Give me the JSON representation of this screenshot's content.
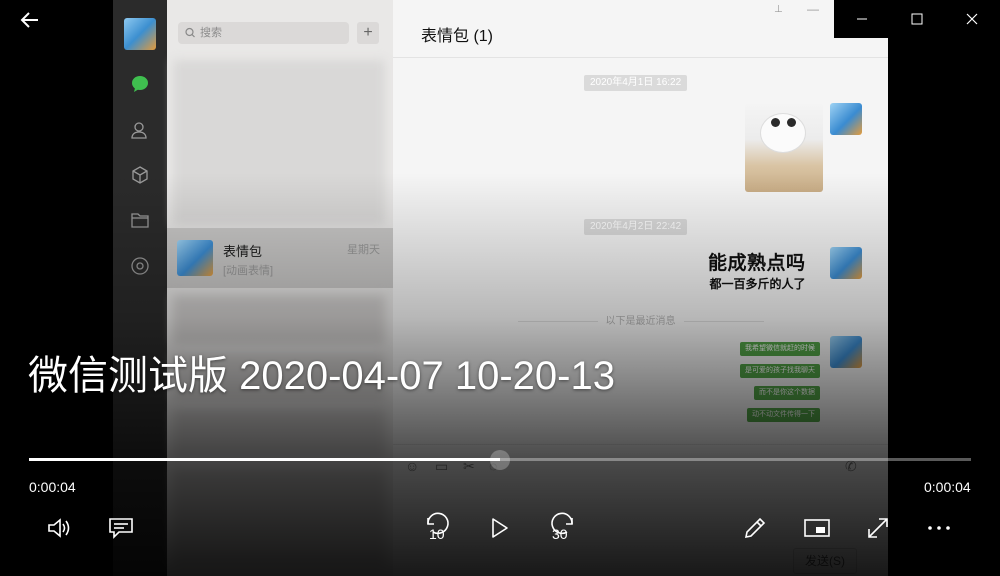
{
  "player": {
    "title": "微信测试版 2020-04-07 10-20-13",
    "time_current": "0:00:04",
    "time_total": "0:00:04",
    "progress": 0.5,
    "skip_back_label": "10",
    "skip_forward_label": "30",
    "icons": {
      "back": "arrow-left-icon",
      "volume": "volume-icon",
      "captions": "captions-icon",
      "skip_back": "skip-back-10-icon",
      "play": "play-icon",
      "skip_forward": "skip-forward-30-icon",
      "edit": "pen-icon",
      "mini_view": "mini-view-icon",
      "fullscreen": "fullscreen-icon",
      "more": "more-icon"
    }
  },
  "window_controls": {
    "minimize": "minimize-icon",
    "maximize": "maximize-icon",
    "close": "close-icon"
  },
  "wechat": {
    "search_placeholder": "搜索",
    "add_button": "+",
    "selected_chat": {
      "name": "表情包",
      "time": "星期天",
      "preview": "[动画表情]"
    },
    "chat_title": "表情包 (1)",
    "timestamps": [
      "2020年4月1日 16:22",
      "2020年4月2日 22:42"
    ],
    "sticker_text_line1": "能成熟点吗",
    "sticker_text_line2": "都一百多斤的人了",
    "recent_divider": "以下是最近消息",
    "bubbles": [
      "我希望微信就赶的时候",
      "是可爱的孩子找我聊天",
      "而不是你这个数据",
      "动不动文件传得一下"
    ],
    "send_button": "发送(S)"
  },
  "colors": {
    "accent_green": "#52a447",
    "background": "#000000",
    "chat_bg": "#f5f5f5"
  }
}
